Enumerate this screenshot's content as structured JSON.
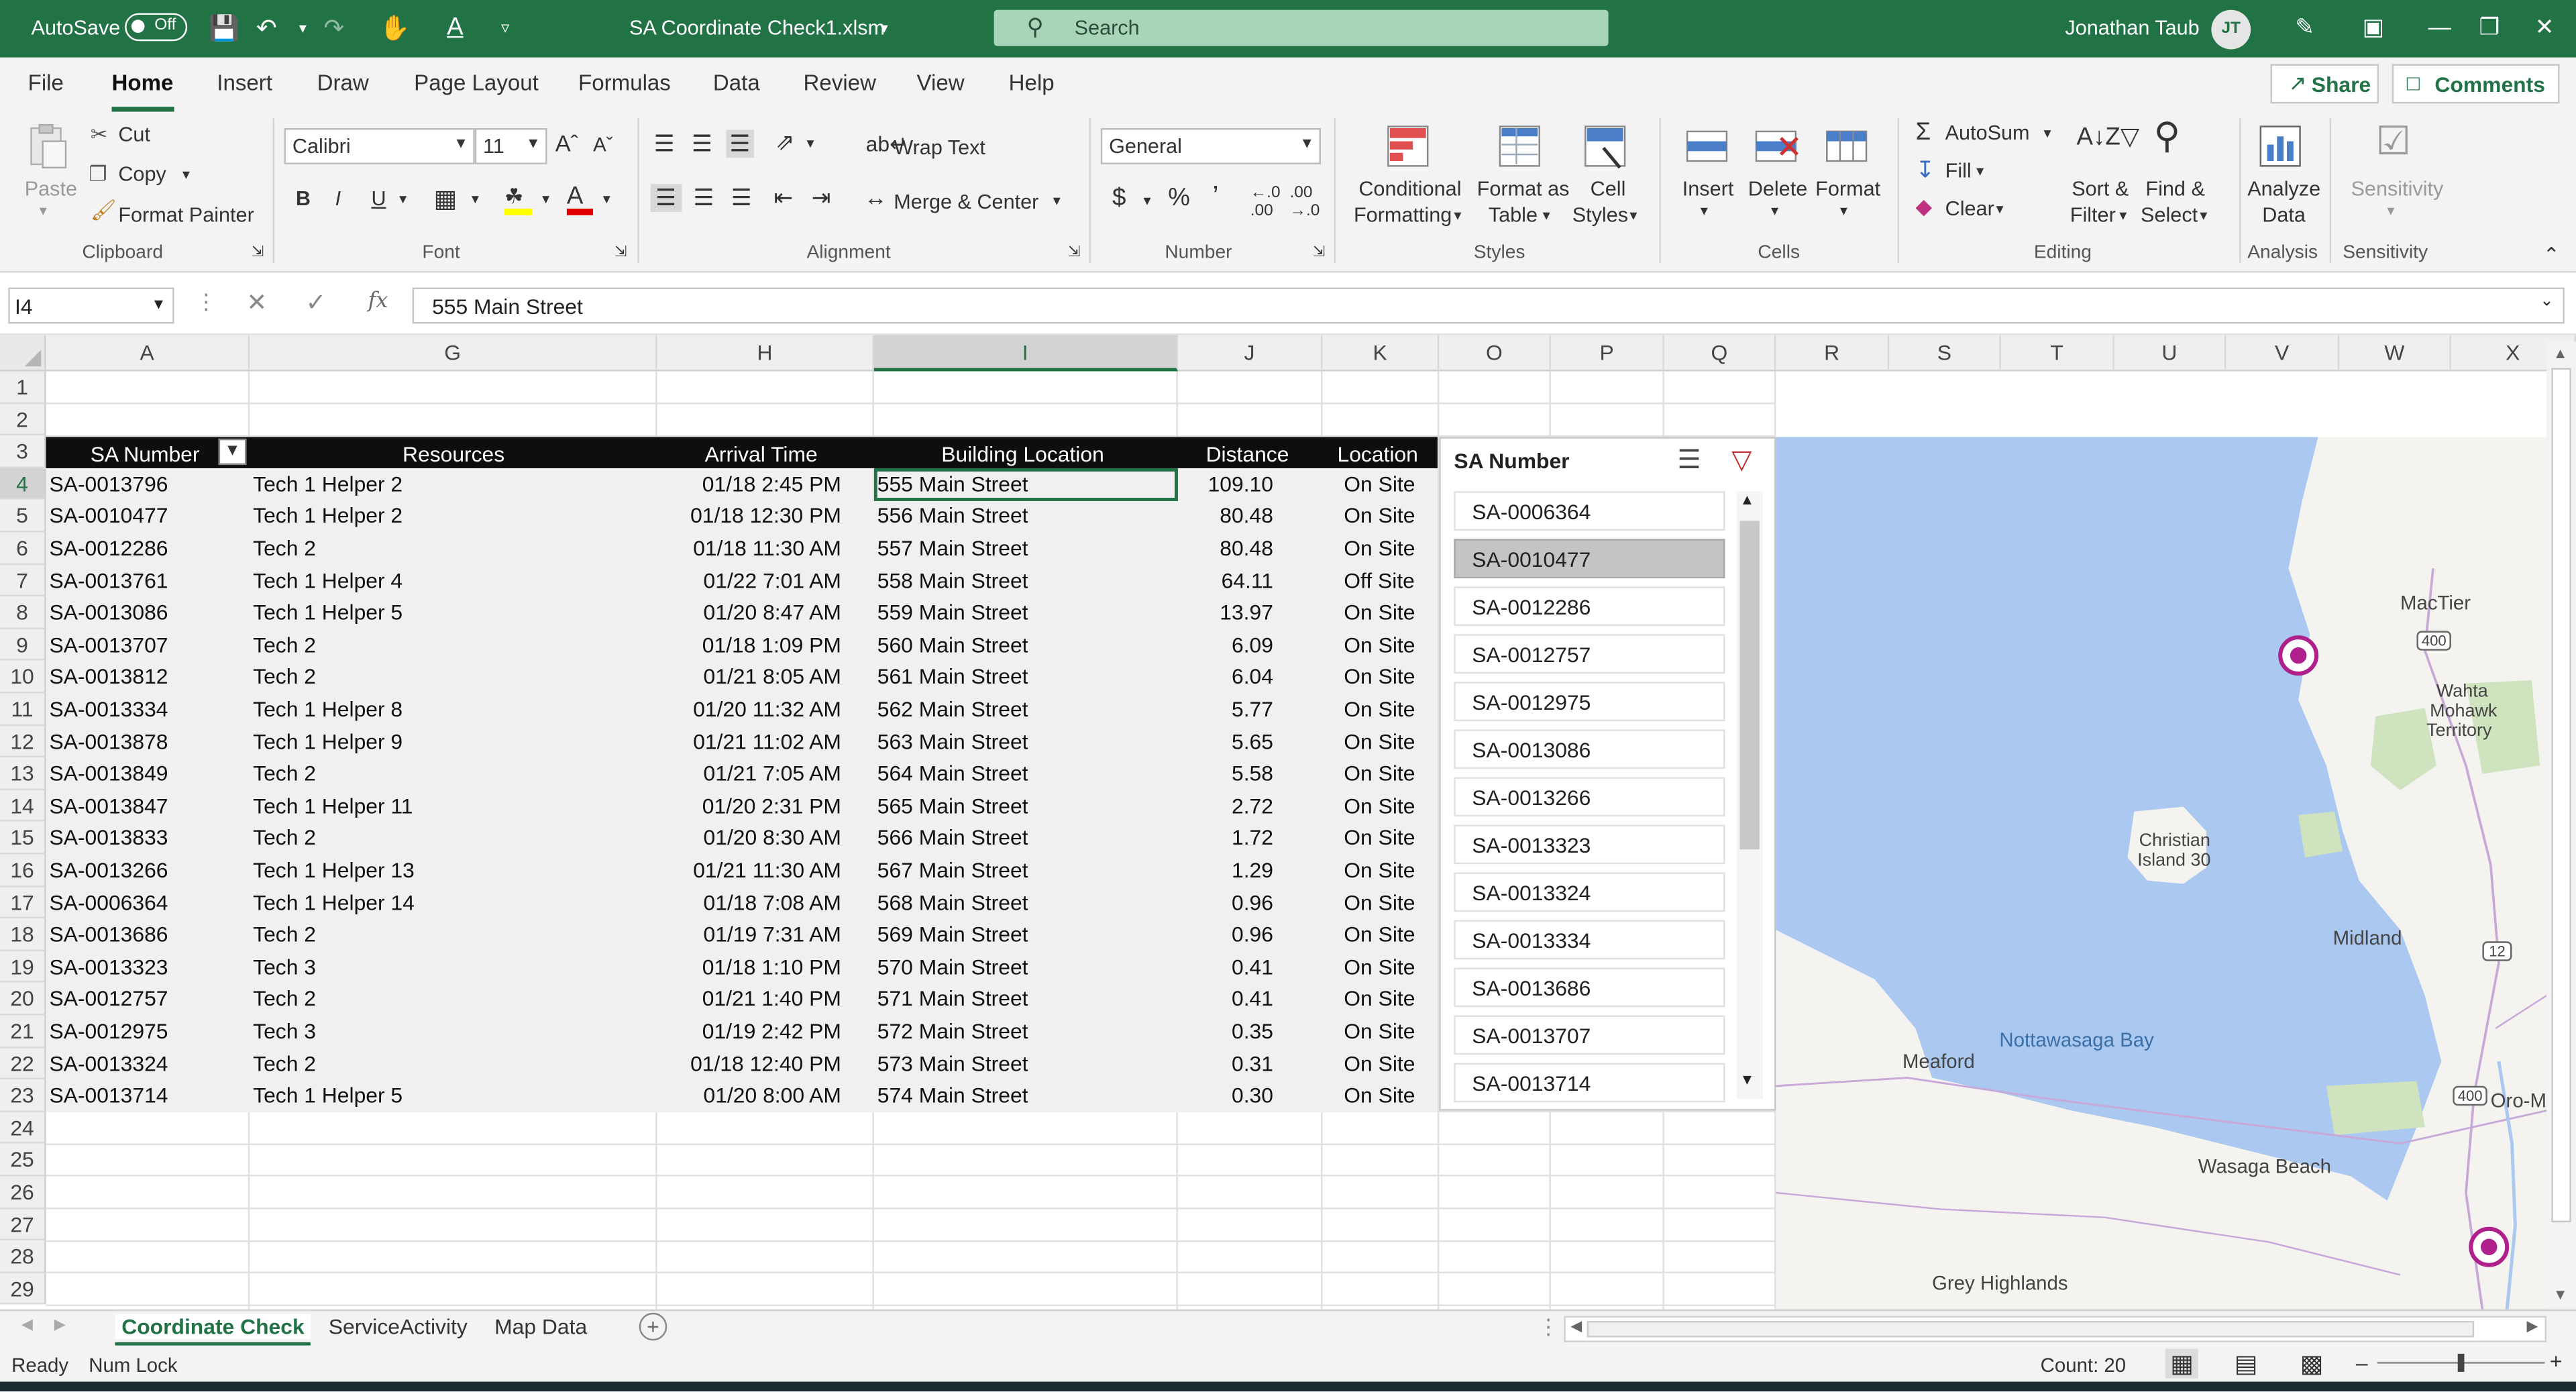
{
  "titlebar": {
    "autosave_label": "AutoSave",
    "autosave_state": "Off",
    "doc_title": "SA Coordinate Check1.xlsm",
    "search_placeholder": "Search",
    "user_name": "Jonathan Taub",
    "user_initials": "JT",
    "accent_color": "#217346"
  },
  "ribbon_tabs": [
    "File",
    "Home",
    "Insert",
    "Draw",
    "Page Layout",
    "Formulas",
    "Data",
    "Review",
    "View",
    "Help"
  ],
  "active_tab": "Home",
  "share_label": "Share",
  "comments_label": "Comments",
  "ribbon": {
    "clipboard": {
      "paste": "Paste",
      "cut": "Cut",
      "copy": "Copy",
      "format_painter": "Format Painter",
      "group": "Clipboard"
    },
    "font": {
      "name": "Calibri",
      "size": "11",
      "group": "Font"
    },
    "alignment": {
      "wrap_text": "Wrap Text",
      "merge_center": "Merge & Center",
      "group": "Alignment"
    },
    "number": {
      "format": "General",
      "group": "Number"
    },
    "styles": {
      "conditional_1": "Conditional",
      "conditional_2": "Formatting",
      "format_table_1": "Format as",
      "format_table_2": "Table",
      "cell_styles_1": "Cell",
      "cell_styles_2": "Styles",
      "group": "Styles"
    },
    "cells": {
      "insert": "Insert",
      "delete": "Delete",
      "format": "Format",
      "group": "Cells"
    },
    "editing": {
      "autosum": "AutoSum",
      "fill": "Fill",
      "clear": "Clear",
      "sort_1": "Sort &",
      "sort_2": "Filter",
      "find_1": "Find &",
      "find_2": "Select",
      "group": "Editing"
    },
    "analysis": {
      "analyze_1": "Analyze",
      "analyze_2": "Data",
      "group": "Analysis"
    },
    "sensitivity": {
      "label": "Sensitivity",
      "group": "Sensitivity"
    }
  },
  "formula_bar": {
    "name_box": "I4",
    "fx": "fx",
    "value": "555 Main Street"
  },
  "columns": [
    "A",
    "G",
    "H",
    "I",
    "J",
    "K",
    "O",
    "P",
    "Q",
    "R",
    "S",
    "T",
    "U",
    "V",
    "W",
    "X"
  ],
  "row_numbers": [
    "1",
    "2",
    "3",
    "4",
    "5",
    "6",
    "7",
    "8",
    "9",
    "10",
    "11",
    "12",
    "13",
    "14",
    "15",
    "16",
    "17",
    "18",
    "19",
    "20",
    "21",
    "22",
    "23",
    "24",
    "25",
    "26",
    "27",
    "28",
    "29"
  ],
  "table": {
    "headers": [
      "SA Number",
      "Resources",
      "Arrival Time",
      "Building Location",
      "Distance",
      "Location"
    ],
    "rows": [
      [
        "SA-0013796",
        "Tech 1 Helper 2",
        "01/18 2:45 PM",
        "555 Main Street",
        "109.10",
        "On Site"
      ],
      [
        "SA-0010477",
        "Tech 1 Helper 2",
        "01/18 12:30 PM",
        "556 Main Street",
        "80.48",
        "On Site"
      ],
      [
        "SA-0012286",
        "Tech 2",
        "01/18 11:30 AM",
        "557 Main Street",
        "80.48",
        "On Site"
      ],
      [
        "SA-0013761",
        "Tech 1 Helper 4",
        "01/22 7:01 AM",
        "558 Main Street",
        "64.11",
        "Off Site"
      ],
      [
        "SA-0013086",
        "Tech 1 Helper 5",
        "01/20 8:47 AM",
        "559 Main Street",
        "13.97",
        "On Site"
      ],
      [
        "SA-0013707",
        "Tech 2",
        "01/18 1:09 PM",
        "560 Main Street",
        "6.09",
        "On Site"
      ],
      [
        "SA-0013812",
        "Tech 2",
        "01/21 8:05 AM",
        "561 Main Street",
        "6.04",
        "On Site"
      ],
      [
        "SA-0013334",
        "Tech 1 Helper 8",
        "01/20 11:32 AM",
        "562 Main Street",
        "5.77",
        "On Site"
      ],
      [
        "SA-0013878",
        "Tech 1 Helper 9",
        "01/21 11:02 AM",
        "563 Main Street",
        "5.65",
        "On Site"
      ],
      [
        "SA-0013849",
        "Tech 2",
        "01/21 7:05 AM",
        "564 Main Street",
        "5.58",
        "On Site"
      ],
      [
        "SA-0013847",
        "Tech 1 Helper 11",
        "01/20 2:31 PM",
        "565 Main Street",
        "2.72",
        "On Site"
      ],
      [
        "SA-0013833",
        "Tech 2",
        "01/20 8:30 AM",
        "566 Main Street",
        "1.72",
        "On Site"
      ],
      [
        "SA-0013266",
        "Tech 1 Helper 13",
        "01/21 11:30 AM",
        "567 Main Street",
        "1.29",
        "On Site"
      ],
      [
        "SA-0006364",
        "Tech 1 Helper 14",
        "01/18 7:08 AM",
        "568 Main Street",
        "0.96",
        "On Site"
      ],
      [
        "SA-0013686",
        "Tech 2",
        "01/19 7:31 AM",
        "569 Main Street",
        "0.96",
        "On Site"
      ],
      [
        "SA-0013323",
        "Tech 3",
        "01/18 1:10 PM",
        "570 Main Street",
        "0.41",
        "On Site"
      ],
      [
        "SA-0012757",
        "Tech 2",
        "01/21 1:40 PM",
        "571 Main Street",
        "0.41",
        "On Site"
      ],
      [
        "SA-0012975",
        "Tech 3",
        "01/19 2:42 PM",
        "572 Main Street",
        "0.35",
        "On Site"
      ],
      [
        "SA-0013324",
        "Tech 2",
        "01/18 12:40 PM",
        "573 Main Street",
        "0.31",
        "On Site"
      ],
      [
        "SA-0013714",
        "Tech 1 Helper 5",
        "01/20 8:00 AM",
        "574 Main Street",
        "0.30",
        "On Site"
      ]
    ]
  },
  "slicer": {
    "title": "SA Number",
    "items": [
      "SA-0006364",
      "SA-0010477",
      "SA-0012286",
      "SA-0012757",
      "SA-0012975",
      "SA-0013086",
      "SA-0013266",
      "SA-0013323",
      "SA-0013324",
      "SA-0013334",
      "SA-0013686",
      "SA-0013707",
      "SA-0013714"
    ],
    "selected": "SA-0010477"
  },
  "map": {
    "labels": [
      "MacTier",
      "Wahta",
      "Mohawk",
      "Territory",
      "Christian",
      "Island 30",
      "Midland",
      "Nottawasaga Bay",
      "Meaford",
      "Oro-M",
      "Wasaga Beach",
      "Grey Highlands"
    ],
    "shields": [
      "400",
      "12",
      "400"
    ],
    "water_color": "#aac8f0",
    "land_color": "#f4f3ef",
    "pin_color": "#b0208c"
  },
  "sheets": [
    "Coordinate Check",
    "ServiceActivity",
    "Map Data"
  ],
  "active_sheet": "Coordinate Check",
  "status": {
    "ready": "Ready",
    "num_lock": "Num Lock",
    "count": "Count: 20"
  }
}
